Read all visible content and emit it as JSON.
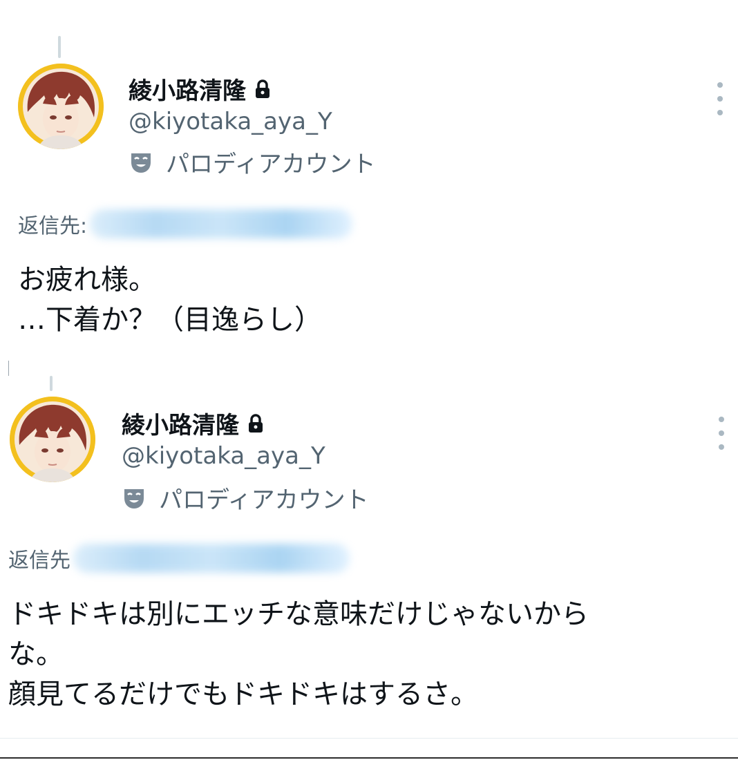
{
  "tweets": [
    {
      "display_name": "綾小路清隆",
      "handle": "@kiyotaka_aya_Y",
      "account_label": "パロディアカウント",
      "reply_prefix": "返信先:",
      "text": "お疲れ様。\n…下着か？（目逸らし）"
    },
    {
      "display_name": "綾小路清隆",
      "handle": "@kiyotaka_aya_Y",
      "account_label": "パロディアカウント",
      "reply_prefix": "返信先",
      "text": "ドキドキは別にエッチな意味だけじゃないから\nな。\n顔見てるだけでもドキドキはするさ。"
    }
  ],
  "icons": {
    "lock": "lock-icon",
    "parody": "mask-icon",
    "more": "more-dots-icon"
  },
  "colors": {
    "avatar_ring": "#f3c01e",
    "secondary_text": "#536471",
    "primary_text": "#0f1419"
  }
}
